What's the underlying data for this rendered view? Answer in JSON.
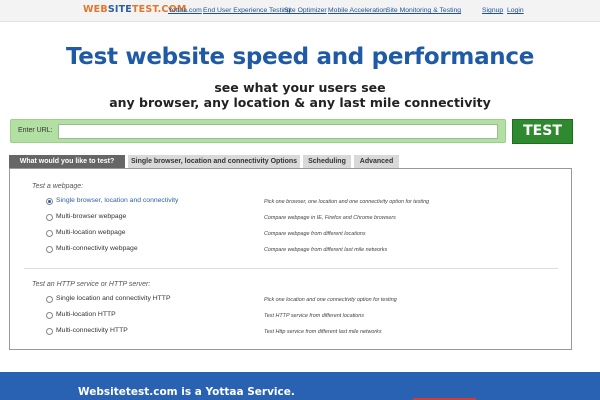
{
  "header": {
    "logo_part1": "WEB",
    "logo_part2": "SITE",
    "logo_part3": "TEST.COM",
    "nav": [
      "Yottaa.com",
      "End User Experience Testing",
      "Site Optimizer",
      "Mobile Acceleration",
      "Site Monitoring & Testing"
    ],
    "signup": "Signup",
    "login": "Login"
  },
  "hero": {
    "title": "Test website speed and performance",
    "subtitle_line1": "see what your users see",
    "subtitle_line2": "any browser, any location & any last mile connectivity"
  },
  "url_form": {
    "label": "Enter URL:",
    "value": "",
    "button_label": "TEST"
  },
  "tabs": [
    {
      "label": "What would you like to test?",
      "active": true
    },
    {
      "label": "Single browser, location and connectivity Options",
      "active": false
    },
    {
      "label": "Scheduling",
      "active": false
    },
    {
      "label": "Advanced",
      "active": false
    }
  ],
  "webpage_section": {
    "title": "Test a webpage:",
    "options": [
      {
        "label": "Single browser, location and connectivity",
        "description": "Pick one browser, one location and one connectivity option for testing",
        "checked": true
      },
      {
        "label": "Multi-browser webpage",
        "description": "Compare webpage in IE, Firefox and Chrome browsers",
        "checked": false
      },
      {
        "label": "Multi-location webpage",
        "description": "Compare webpage from different locations",
        "checked": false
      },
      {
        "label": "Multi-connectivity webpage",
        "description": "Compare webpage from different last mile networks",
        "checked": false
      }
    ]
  },
  "http_section": {
    "title": "Test an HTTP service or HTTP server:",
    "options": [
      {
        "label": "Single location and connectivity HTTP",
        "description": "Pick one location and one connectivity option for testing",
        "checked": false
      },
      {
        "label": "Multi-location HTTP",
        "description": "Test HTTP service from different locations",
        "checked": false
      },
      {
        "label": "Multi-connectivity HTTP",
        "description": "Test Http service from different last mile networks",
        "checked": false
      }
    ]
  },
  "footer": {
    "text": "Websitetest.com is a Yottaa Service."
  },
  "colors": {
    "brand_blue": "#1f5aa6",
    "logo_orange": "#e2762a",
    "url_bar_green": "#b2e0a3",
    "test_button_green": "#2f8a2f",
    "footer_blue": "#2a62b3"
  }
}
